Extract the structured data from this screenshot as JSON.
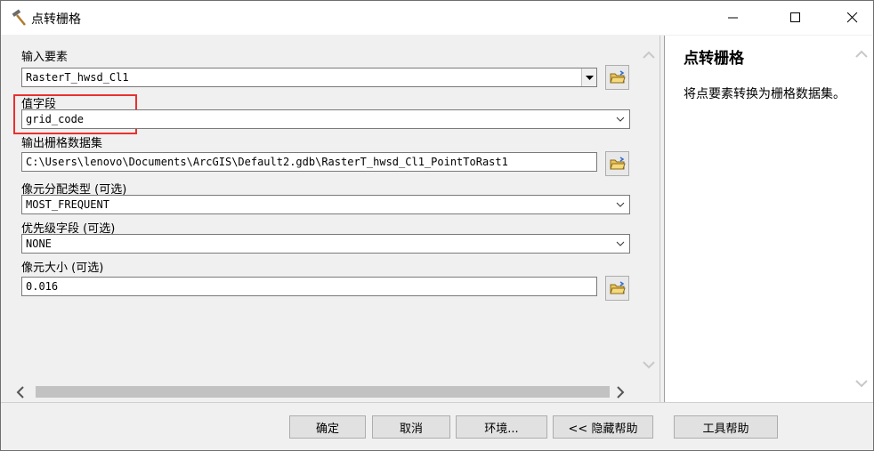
{
  "window": {
    "title": "点转栅格",
    "minimize_label": "—",
    "maximize_label": "☐",
    "close_label": "✕"
  },
  "form": {
    "input_features": {
      "label": "输入要素",
      "value": "RasterT_hwsd_Cl1"
    },
    "value_field": {
      "label": "值字段",
      "value": "grid_code"
    },
    "output_raster": {
      "label": "输出栅格数据集",
      "value": "C:\\Users\\lenovo\\Documents\\ArcGIS\\Default2.gdb\\RasterT_hwsd_Cl1_PointToRast1"
    },
    "cell_assignment": {
      "label": "像元分配类型 (可选)",
      "value": "MOST_FREQUENT"
    },
    "priority_field": {
      "label": "优先级字段 (可选)",
      "value": "NONE"
    },
    "cell_size": {
      "label": "像元大小 (可选)",
      "value": "0.016"
    }
  },
  "help": {
    "title": "点转栅格",
    "text": "将点要素转换为栅格数据集。"
  },
  "buttons": {
    "ok": "确定",
    "cancel": "取消",
    "environments": "环境...",
    "hide_help": "<< 隐藏帮助",
    "tool_help": "工具帮助"
  },
  "colors": {
    "highlight_box": "#e8312f"
  }
}
